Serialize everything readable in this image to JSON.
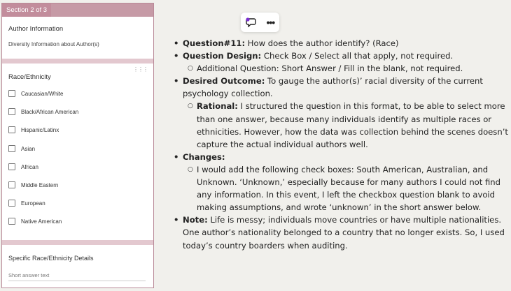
{
  "form": {
    "section_tab": "Section 2 of 3",
    "section_title": "Author Information",
    "section_description": "Diversity Information about Author(s)",
    "question1_title": "Race/Ethnicity",
    "options": [
      "Caucasian/White",
      "Black/African American",
      "Hispanic/Latinx",
      "Asian",
      "African",
      "Middle Eastern",
      "European",
      "Native American"
    ],
    "question2_title": "Specific Race/Ethnicity Details",
    "short_answer_placeholder": "Short answer text"
  },
  "toolbar": {
    "comment_icon": "add-comment-icon",
    "more_icon": "more-horizontal-icon"
  },
  "notes": {
    "q_label": "Question#11:",
    "q_text": " How does the author identify? (Race)",
    "design_label": "Question Design:",
    "design_text": " Check Box / Select all that apply, not required.",
    "design_sub": "Additional Question: Short Answer / Fill in the blank, not required.",
    "outcome_label": "Desired Outcome:",
    "outcome_text": " To gauge the author(s)’ racial diversity of the current psychology collection.",
    "rationale_label": "Rational:",
    "rationale_text": " I structured the question in this format, to be able to select more than one answer, because many individuals identify as multiple races or ethnicities. However, how the data was collection behind the scenes doesn’t capture the actual individual authors well.",
    "changes_label": "Changes:",
    "changes_text": "I would add the following check boxes: South American, Australian, and Unknown. ‘Unknown,’ especially because for many authors I could not find any information. In this event, I left the checkbox question blank to avoid making assumptions, and wrote ‘unknown’ in the short answer below.",
    "note_label": "Note:",
    "note_text": " Life is messy; individuals move countries or have multiple nationalities. One author’s nationality belonged to a country that no longer exists. So, I used today’s country boarders when auditing."
  }
}
